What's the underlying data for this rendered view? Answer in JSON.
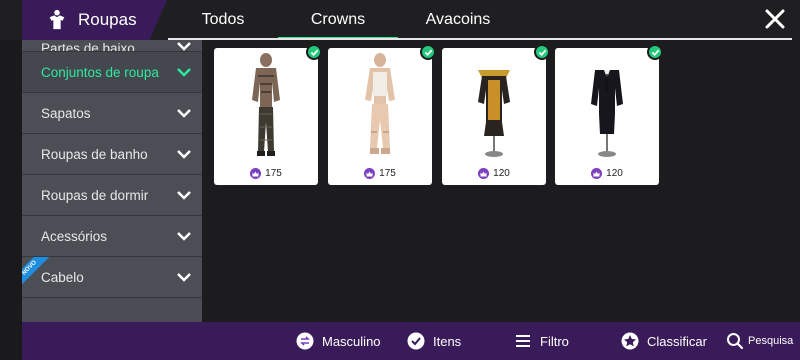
{
  "header": {
    "title": "Roupas",
    "tabs": [
      {
        "label": "Todos"
      },
      {
        "label": "Crowns"
      },
      {
        "label": "Avacoins"
      }
    ]
  },
  "sidebar": {
    "items": [
      {
        "label": "Partes de baixo"
      },
      {
        "label": "Conjuntos de roupa"
      },
      {
        "label": "Sapatos"
      },
      {
        "label": "Roupas de banho"
      },
      {
        "label": "Roupas de dormir"
      },
      {
        "label": "Acessórios"
      },
      {
        "label": "Cabelo",
        "badge": "NOVO"
      }
    ]
  },
  "items": [
    {
      "price": "175",
      "icon": "tattooed-outfit-figure"
    },
    {
      "price": "175",
      "icon": "beige-outfit-figure"
    },
    {
      "price": "120",
      "icon": "gold-robe-figure"
    },
    {
      "price": "120",
      "icon": "black-suit-figure"
    }
  ],
  "bottombar": {
    "gender": "Masculino",
    "items": "Itens",
    "filter": "Filtro",
    "sort": "Classificar",
    "search": "Pesquisa"
  },
  "colors": {
    "accent": "#2ee8a0",
    "brand": "#3a1b5a",
    "owned_check": "#23c87a",
    "currency": "#7b3fbf",
    "new_badge": "#1e8fe0"
  }
}
